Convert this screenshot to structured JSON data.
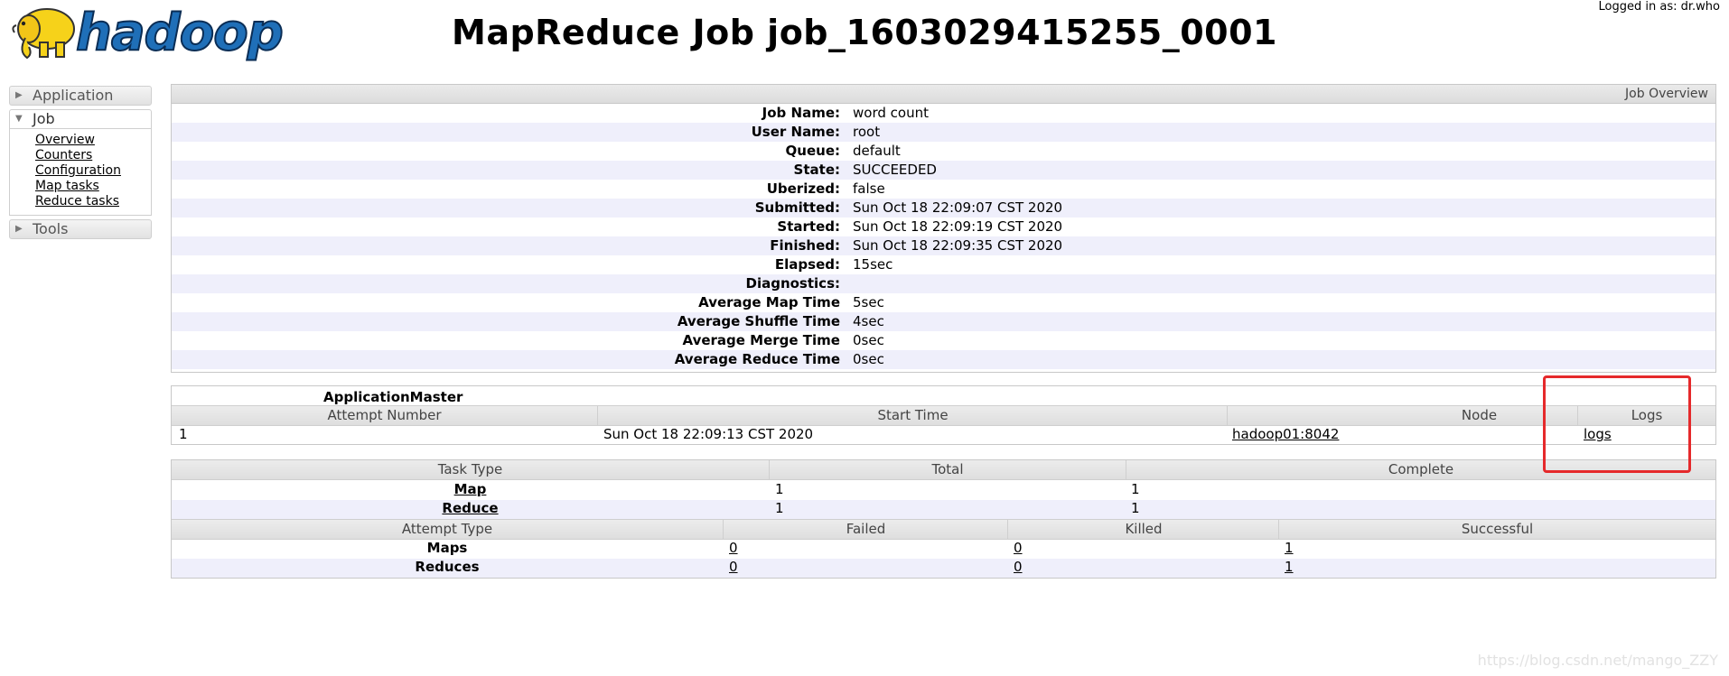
{
  "header": {
    "logo_text": "hadoop",
    "title": "MapReduce Job job_1603029415255_0001",
    "login": "Logged in as: dr.who"
  },
  "nav": {
    "application": "Application",
    "job": "Job",
    "job_links": [
      "Overview",
      "Counters",
      "Configuration",
      "Map tasks",
      "Reduce tasks"
    ],
    "tools": "Tools"
  },
  "overview": {
    "caption": "Job Overview",
    "rows": [
      {
        "label": "Job Name:",
        "value": "word count"
      },
      {
        "label": "User Name:",
        "value": "root"
      },
      {
        "label": "Queue:",
        "value": "default"
      },
      {
        "label": "State:",
        "value": "SUCCEEDED"
      },
      {
        "label": "Uberized:",
        "value": "false"
      },
      {
        "label": "Submitted:",
        "value": "Sun Oct 18 22:09:07 CST 2020"
      },
      {
        "label": "Started:",
        "value": "Sun Oct 18 22:09:19 CST 2020"
      },
      {
        "label": "Finished:",
        "value": "Sun Oct 18 22:09:35 CST 2020"
      },
      {
        "label": "Elapsed:",
        "value": "15sec"
      },
      {
        "label": "Diagnostics:",
        "value": ""
      },
      {
        "label": "Average Map Time",
        "value": "5sec"
      },
      {
        "label": "Average Shuffle Time",
        "value": "4sec"
      },
      {
        "label": "Average Merge Time",
        "value": "0sec"
      },
      {
        "label": "Average Reduce Time",
        "value": "0sec"
      }
    ]
  },
  "application_master": {
    "caption": "ApplicationMaster",
    "headers": [
      "Attempt Number",
      "Start Time",
      "Node",
      "Logs"
    ],
    "row": {
      "attempt": "1",
      "start_time": "Sun Oct 18 22:09:13 CST 2020",
      "node": "hadoop01:8042",
      "logs": "logs"
    }
  },
  "tasks": {
    "headers": [
      "Task Type",
      "Total",
      "Complete"
    ],
    "rows": [
      {
        "type": "Map",
        "total": "1",
        "complete": "1"
      },
      {
        "type": "Reduce",
        "total": "1",
        "complete": "1"
      }
    ],
    "attempt_headers": [
      "Attempt Type",
      "Failed",
      "Killed",
      "Successful"
    ],
    "attempt_rows": [
      {
        "type": "Maps",
        "failed": "0",
        "killed": "0",
        "successful": "1"
      },
      {
        "type": "Reduces",
        "failed": "0",
        "killed": "0",
        "successful": "1"
      }
    ]
  },
  "watermark": "https://blog.csdn.net/mango_ZZY",
  "colors": {
    "highlight": "#e5292b",
    "odd_row": "#efeffb"
  }
}
